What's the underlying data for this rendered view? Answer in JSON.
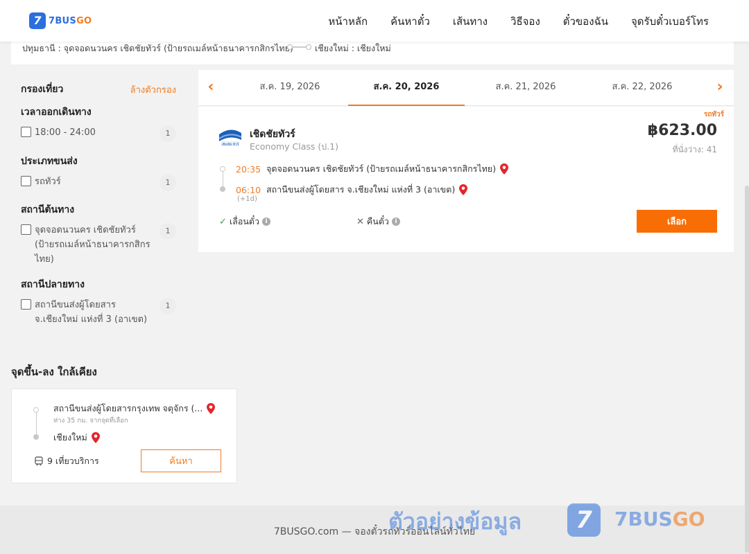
{
  "header": {
    "logo_mark": "7",
    "logo_main": "7BUS",
    "logo_accent": "GO",
    "nav": [
      "หน้าหลัก",
      "ค้นหาตั๋ว",
      "เส้นทาง",
      "วิธีจอง",
      "ตั๋วของฉัน",
      "จุดรับตั๋วเบอร์โทร"
    ]
  },
  "route": {
    "from": "ปทุมธานี : จุดจอดนวนคร เชิดชัยทัวร์ (ป้ายรถเมล์หน้าธนาคารกสิกรไทย)",
    "to": "เชียงใหม่ : เชียงใหม่"
  },
  "filters": {
    "title": "กรองเที่ยว",
    "clear": "ล้างตัวกรอง",
    "groups": [
      {
        "title": "เวลาออกเดินทาง",
        "option": "18:00 - 24:00",
        "count": "1"
      },
      {
        "title": "ประเภทขนส่ง",
        "option": "รถทัวร์",
        "count": "1"
      },
      {
        "title": "สถานีต้นทาง",
        "option": "จุดจอดนวนคร เชิดชัยทัวร์ (ป้ายรถเมล์หน้าธนาคารกสิกรไทย)",
        "count": "1"
      },
      {
        "title": "สถานีปลายทาง",
        "option": "สถานีขนส่งผู้โดยสาร จ.เชียงใหม่ แห่งที่ 3 (อาเขต)",
        "count": "1"
      }
    ]
  },
  "dates": [
    "ส.ค. 19, 2026",
    "ส.ค. 20, 2026",
    "ส.ค. 21, 2026",
    "ส.ค. 22, 2026"
  ],
  "trip": {
    "badge": "รถทัวร์",
    "operator": "เชิดชัยทัวร์",
    "class": "Economy Class (ป.1)",
    "price": "฿623.00",
    "seats": "ที่นั่งว่าง: 41",
    "depart_time": "20:35",
    "depart_station": "จุดจอดนวนคร เชิดชัยทัวร์ (ป้ายรถเมล์หน้าธนาคารกสิกรไทย)",
    "arrive_time": "06:10",
    "arrive_station": "สถานีขนส่งผู้โดยสาร จ.เชียงใหม่ แห่งที่ 3 (อาเขต)",
    "next_day": "(+1d)",
    "policy_change": "เลื่อนตั๋ว",
    "policy_refund": "คืนตั๋ว",
    "select_label": "เลือก",
    "op_logo_text": "เชิดชัย ทัวร์"
  },
  "nearby": {
    "title": "จุดขึ้น-ลง ใกล้เคียง",
    "from": "สถานีขนส่งผู้โดยสารกรุงเทพ จตุจักร (...",
    "distance": "ห่าง 35 กม. จากจุดที่เลือก",
    "to": "เชียงใหม่",
    "trips": "9 เที่ยวบริการ",
    "search_label": "ค้นหา"
  },
  "footer": {
    "text": "7BUSGO.com — จองตั๋วรถทัวร์ออนไลน์ทั่วไทย"
  },
  "watermark": {
    "text": "ตัวอย่างข้อมูล",
    "badge": "7",
    "brand_main": "7BUS",
    "brand_accent": "GO"
  },
  "colors": {
    "accent": "#f07b22",
    "button": "#f86d04",
    "brand": "#2b6fde"
  },
  "active_date_index": 1
}
